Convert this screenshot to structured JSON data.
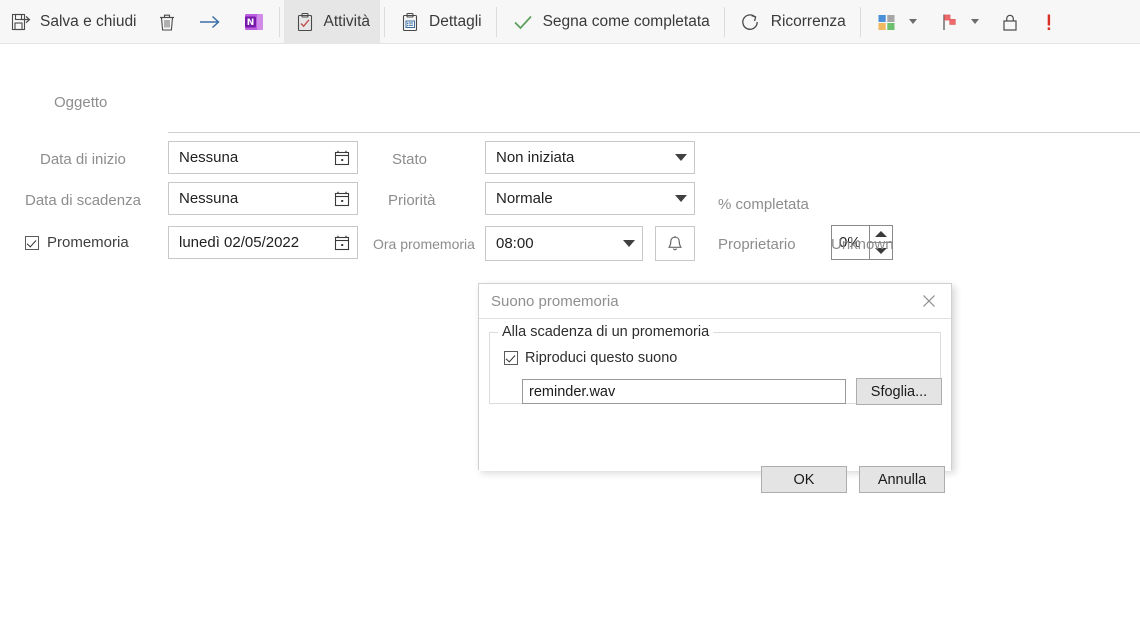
{
  "window": {
    "app": "Outlook Task",
    "language": "it"
  },
  "toolbar": {
    "items": [
      {
        "id": "save-close",
        "label": "Salva e chiudi",
        "icon": "save-and-close-icon",
        "active": false
      },
      {
        "id": "delete",
        "label": "",
        "icon": "trash-icon",
        "active": false
      },
      {
        "id": "forward",
        "label": "",
        "icon": "arrow-right-icon",
        "active": false
      },
      {
        "id": "onenote",
        "label": "",
        "icon": "onenote-icon",
        "active": false
      },
      {
        "id": "task",
        "label": "Attività",
        "icon": "clipboard-task-icon",
        "active": true
      },
      {
        "id": "details",
        "label": "Dettagli",
        "icon": "clipboard-details-icon",
        "active": false
      },
      {
        "id": "complete",
        "label": "Segna come completata",
        "icon": "check-icon",
        "active": false
      },
      {
        "id": "recurrence",
        "label": "Ricorrenza",
        "icon": "recurrence-icon",
        "active": false
      },
      {
        "id": "categorize",
        "label": "",
        "icon": "categorize-icon",
        "active": false
      },
      {
        "id": "followup",
        "label": "",
        "icon": "flag-icon",
        "active": false
      },
      {
        "id": "private",
        "label": "",
        "icon": "lock-icon",
        "active": false
      },
      {
        "id": "high-importance",
        "label": "",
        "icon": "exclamation-icon",
        "active": false
      }
    ]
  },
  "form": {
    "subject": {
      "label": "Oggetto",
      "value": "",
      "placeholder": ""
    },
    "start_date": {
      "label": "Data di inizio",
      "value": "Nessuna",
      "icon": "calendar-icon"
    },
    "due_date": {
      "label": "Data di scadenza",
      "value": "Nessuna",
      "icon": "calendar-icon"
    },
    "reminder": {
      "label": "Promemoria",
      "checked": true,
      "date": "lunedì 02/05/2022",
      "time_label": "Ora promemoria",
      "time": "08:00",
      "sound_icon": "bell-icon"
    },
    "status": {
      "label": "Stato",
      "value": "Non iniziata"
    },
    "priority": {
      "label": "Priorità",
      "value": "Normale"
    },
    "percent_complete": {
      "label": "% completata",
      "value": "0%"
    },
    "owner": {
      "label": "Proprietario",
      "value": "Unknown"
    }
  },
  "dialog": {
    "title": "Suono promemoria",
    "close_icon": "close-icon",
    "group_legend": "Alla scadenza di un promemoria",
    "play_sound": {
      "label": "Riproduci questo suono",
      "checked": true
    },
    "sound_file": "reminder.wav",
    "browse_label": "Sfoglia...",
    "ok_label": "OK",
    "cancel_label": "Annulla"
  },
  "colors": {
    "ribbon_bg": "#f7f7f7",
    "active_tab_bg": "#e6e6e6",
    "onenote_purple": "#7719aa",
    "check_green": "#5aa05a",
    "flag_red": "#ef6b6b",
    "importance_red": "#d93025",
    "label_gray": "#8d8d8d"
  }
}
